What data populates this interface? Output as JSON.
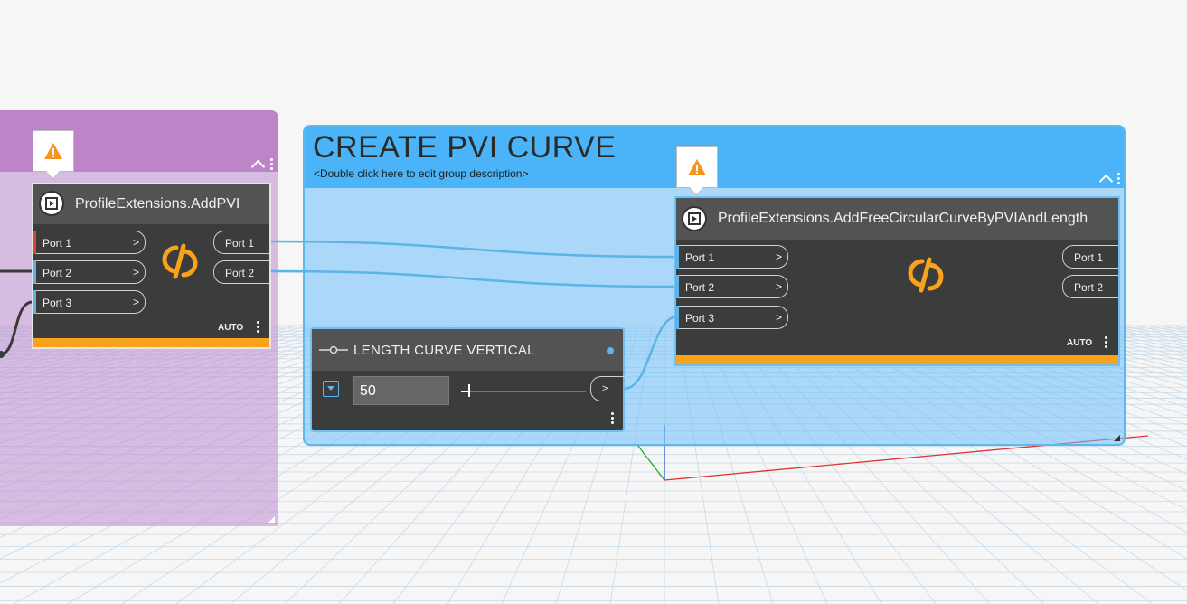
{
  "groups": {
    "purple": {
      "color": "#bd84c7"
    },
    "blue": {
      "title": "CREATE PVI CURVE",
      "description": "<Double click here to edit group description>",
      "color": "#4bb4f8"
    }
  },
  "nodes": {
    "add_pvi": {
      "title": "ProfileExtensions.AddPVI",
      "inputs": [
        "Port 1",
        "Port 2",
        "Port 3"
      ],
      "outputs": [
        "Port 1",
        "Port 2"
      ],
      "lacing": "AUTO"
    },
    "add_curve": {
      "title": "ProfileExtensions.AddFreeCircularCurveByPVIAndLength",
      "inputs": [
        "Port 1",
        "Port 2",
        "Port 3"
      ],
      "outputs": [
        "Port 1",
        "Port 2"
      ],
      "lacing": "AUTO"
    },
    "slider": {
      "title": "LENGTH CURVE VERTICAL",
      "value": "50",
      "output_label": ">"
    }
  },
  "icons": {
    "warning": "warning-icon",
    "node_type": "node-type-icon",
    "logo": "dynamo-logo-icon",
    "chevron": "collapse-chevron-icon"
  },
  "colors": {
    "accent": "#f9a21b",
    "wire": "#5ab4e6",
    "node_body": "#3c3c3c",
    "node_header": "#535353"
  }
}
